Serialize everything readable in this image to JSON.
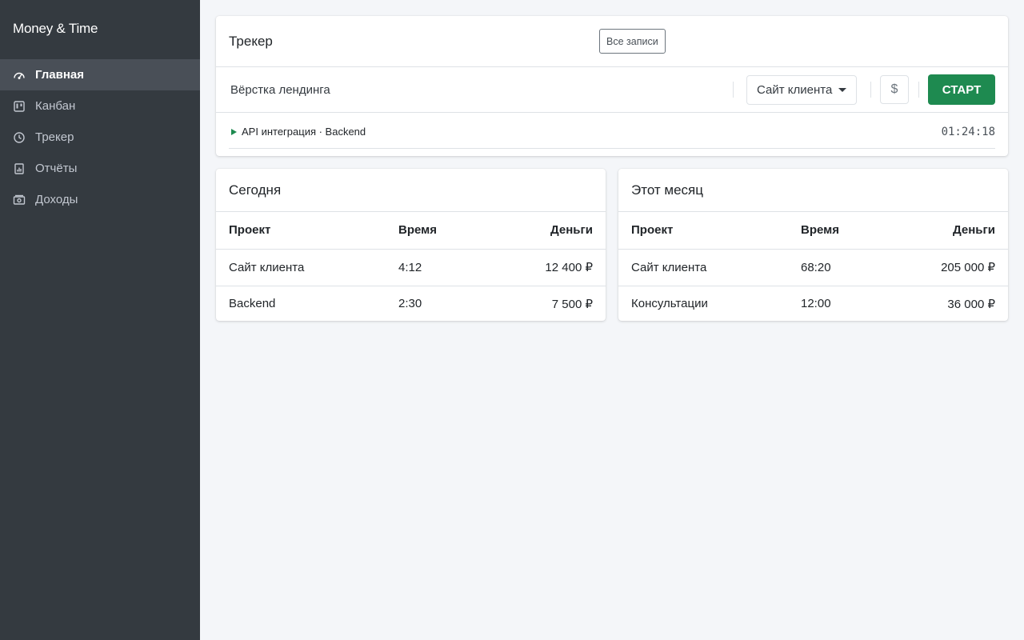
{
  "sidebar": {
    "brand": "Money & Time",
    "items": [
      {
        "label": "Главная",
        "icon": "dashboard-icon",
        "active": true
      },
      {
        "label": "Канбан",
        "icon": "kanban-icon",
        "active": false
      },
      {
        "label": "Трекер",
        "icon": "clock-icon",
        "active": false
      },
      {
        "label": "Отчёты",
        "icon": "report-icon",
        "active": false
      },
      {
        "label": "Доходы",
        "icon": "money-icon",
        "active": false
      }
    ]
  },
  "tracker": {
    "title": "Трекер",
    "all_records_label": "Все записи",
    "task_value": "Вёрстка лендинга",
    "project_selected": "Сайт клиента",
    "billable_label": "$",
    "start_label": "СТАРТ",
    "entry": {
      "label": "API интеграция · Backend",
      "timer": "01:24:18"
    }
  },
  "today": {
    "title": "Сегодня",
    "headers": [
      "Проект",
      "Время",
      "Деньги"
    ],
    "rows": [
      [
        "Сайт клиента",
        "4:12",
        "12 400 ₽"
      ],
      [
        "Backend",
        "2:30",
        "7 500 ₽"
      ]
    ]
  },
  "month": {
    "title": "Этот месяц",
    "headers": [
      "Проект",
      "Время",
      "Деньги"
    ],
    "rows": [
      [
        "Сайт клиента",
        "68:20",
        "205 000 ₽"
      ],
      [
        "Консультации",
        "12:00",
        "36 000 ₽"
      ]
    ]
  },
  "colors": {
    "sidebar_bg": "#343a40",
    "active_item_bg": "#494f57",
    "accent_green": "#1e8a50",
    "page_bg": "#f4f6f9"
  }
}
